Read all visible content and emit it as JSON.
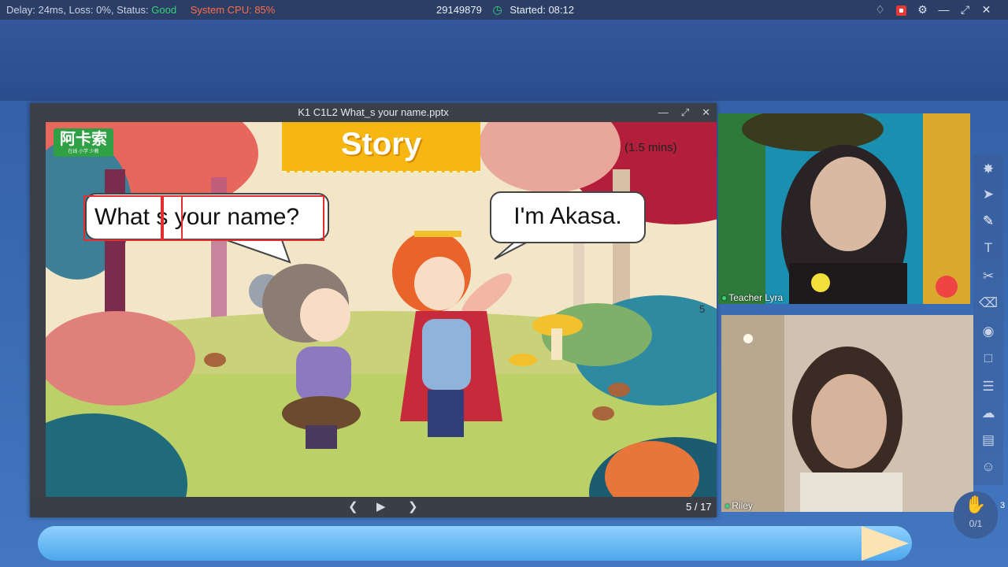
{
  "status": {
    "delay_label": "Delay: 24ms, Loss: 0%, Status:",
    "status_value": "Good",
    "cpu_label": "System CPU: 85%",
    "room_id": "29149879",
    "started": "Started: 08:12"
  },
  "presentation": {
    "file_title": "K1 C1L2 What_s your name.pptx",
    "pager": "5 / 17",
    "slide": {
      "logo_text": "阿卡索",
      "logo_sub": "在线 小学 少教",
      "banner": "Story",
      "duration": "(1.5 mins)",
      "bubble_left": "What s your name?",
      "bubble_right": "I'm Akasa.",
      "corner_number": "5"
    }
  },
  "videos": {
    "teacher_name": "Teacher Lyra",
    "student_name": "Riley"
  },
  "raise_hand": {
    "count": "0/1"
  },
  "side_count": "3",
  "colors": {
    "good": "#3ad17a",
    "cpu_warning": "#ff6b4a",
    "annotation_red": "#e23030",
    "banner_yellow": "#f7b712"
  },
  "icons": {
    "statusbar": [
      "bell-icon",
      "record-icon",
      "gear-icon",
      "minimize-icon",
      "restore-icon",
      "close-icon"
    ],
    "toolbar": [
      "laser-pointer-icon",
      "select-arrow-icon",
      "pen-icon",
      "text-icon",
      "scissors-icon",
      "trash-icon",
      "spotlight-icon",
      "edit-board-icon",
      "chat-icon",
      "cloud-icon",
      "toolbox-icon",
      "users-icon"
    ]
  }
}
